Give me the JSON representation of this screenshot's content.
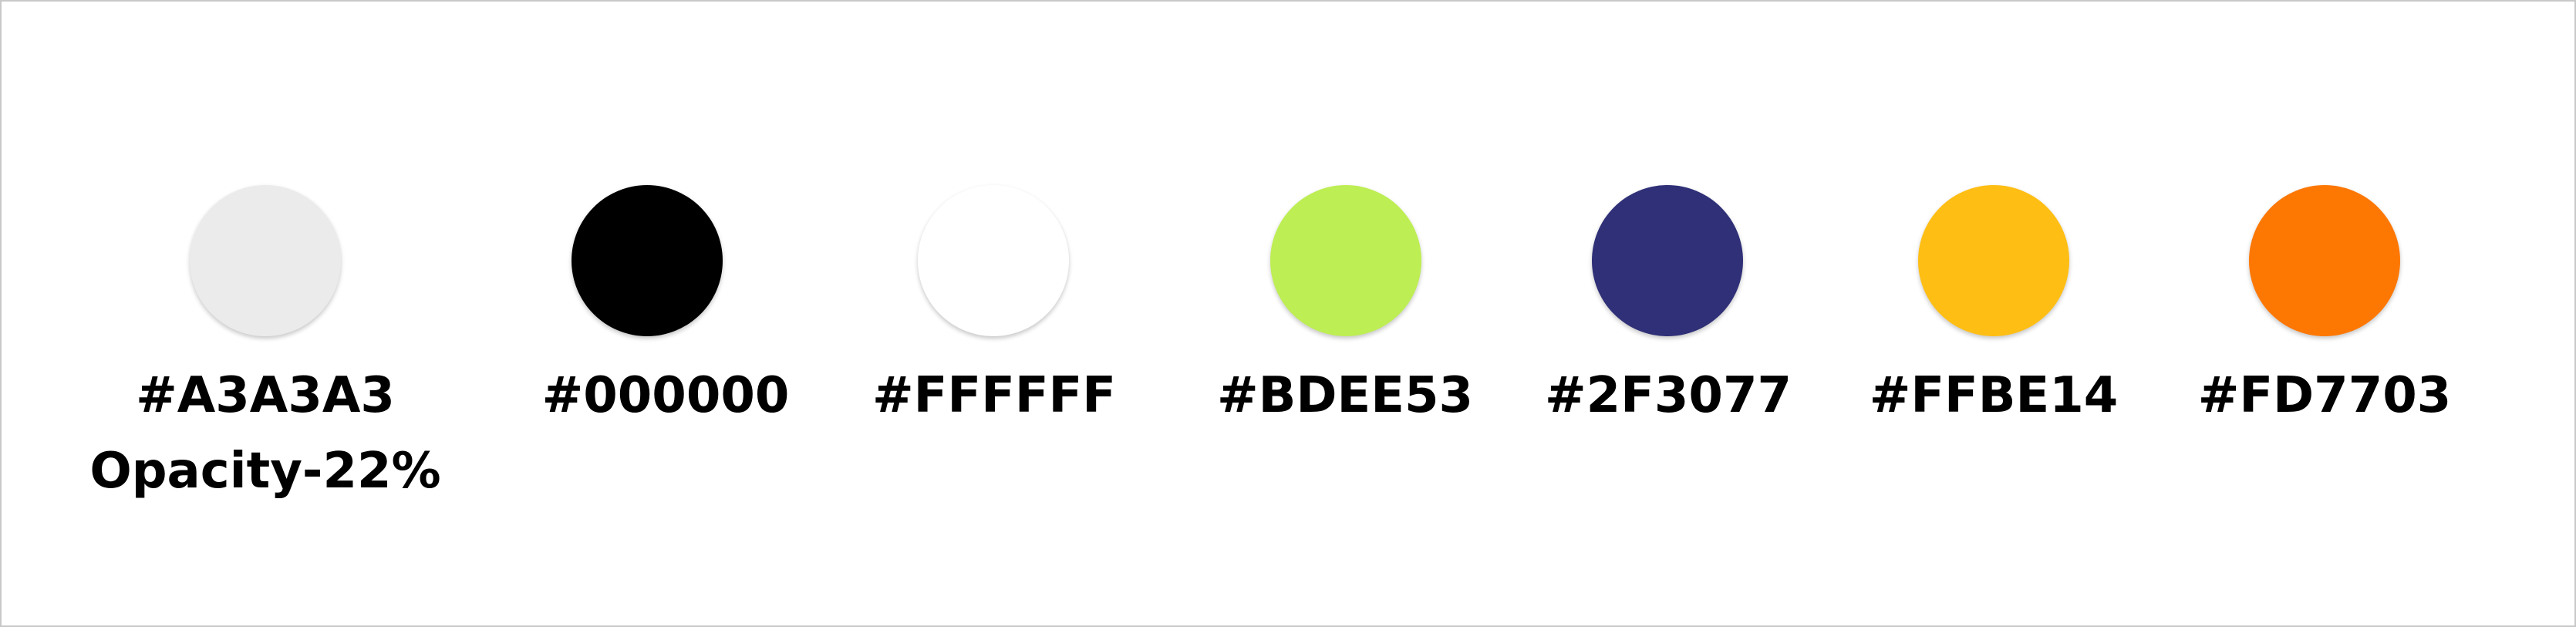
{
  "swatches": [
    {
      "hex": "#A3A3A3",
      "opacity_label": "Opacity-22%",
      "color": "#A3A3A3",
      "opacity": 0.22
    },
    {
      "hex": "#000000",
      "color": "#000000",
      "opacity": 1
    },
    {
      "hex": "#FFFFFF",
      "color": "#FFFFFF",
      "opacity": 1
    },
    {
      "hex": "#BDEE53",
      "color": "#BDEE53",
      "opacity": 1
    },
    {
      "hex": "#2F3077",
      "color": "#2F3077",
      "opacity": 1
    },
    {
      "hex": "#FFBE14",
      "color": "#FFBE14",
      "opacity": 1
    },
    {
      "hex": "#FD7703",
      "color": "#FD7703",
      "opacity": 1
    }
  ]
}
